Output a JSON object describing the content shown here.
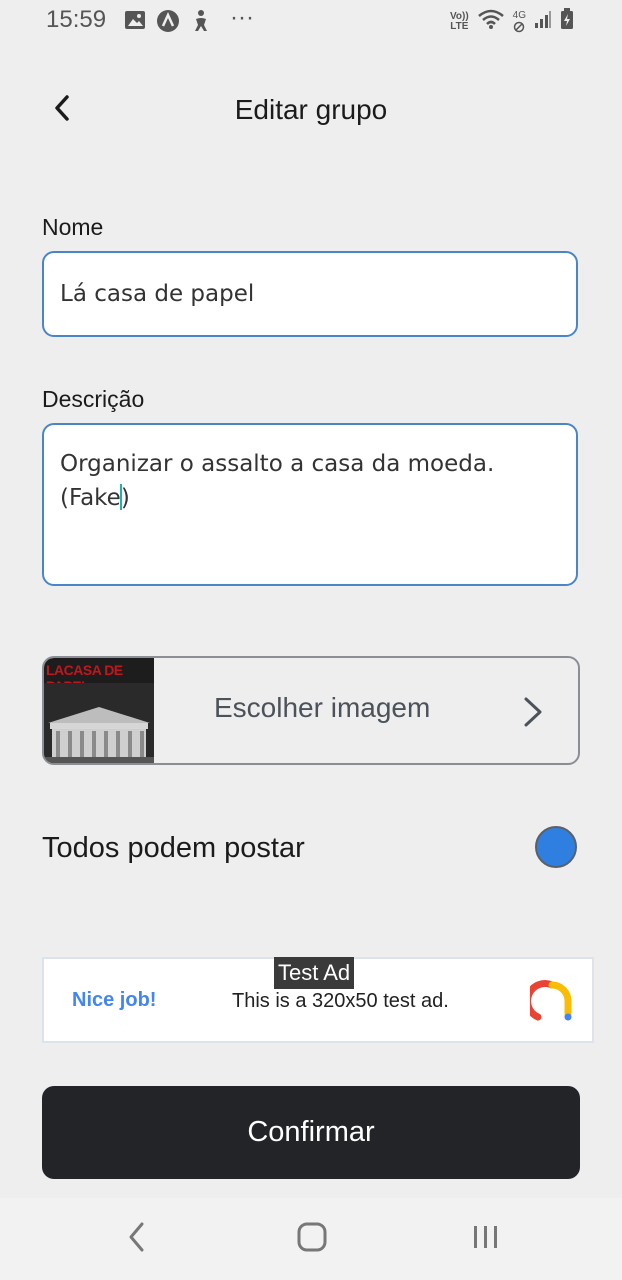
{
  "status_bar": {
    "time": "15:59",
    "dots": "···",
    "volte_top": "Vo))",
    "volte_bottom": "LTE",
    "network": "4G"
  },
  "header": {
    "title": "Editar grupo"
  },
  "form": {
    "name_label": "Nome",
    "name_value": "Lá casa de papel",
    "description_label": "Descrição",
    "description_line1": "Organizar o assalto a casa da moeda.",
    "description_line2_before_caret": "(Fake",
    "description_line2_after_caret": ")",
    "image_thumb_title": "LACASA DE PAPEL",
    "image_choose_label": "Escolher imagem",
    "everyone_can_post_label": "Todos podem postar",
    "everyone_can_post_color": "#2f7fe0"
  },
  "ad": {
    "tag": "Test Ad",
    "headline": "Nice job!",
    "text": "This is a 320x50 test ad."
  },
  "actions": {
    "confirm_label": "Confirmar"
  },
  "colors": {
    "background": "#eeeeee",
    "input_border": "#4a84c9",
    "primary_button": "#222428",
    "toggle": "#2f7fe0"
  }
}
